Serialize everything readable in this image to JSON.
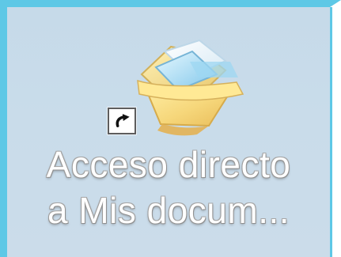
{
  "shortcut": {
    "icon_name": "my-documents-folder-icon",
    "overlay_icon_name": "shortcut-arrow-icon",
    "label_line_1": "Acceso directo",
    "label_line_2": "a Mis docum..."
  },
  "colors": {
    "frame": "#5ec8e6",
    "desktop_background": "#c8dbea",
    "label_text": "#ffffff"
  }
}
